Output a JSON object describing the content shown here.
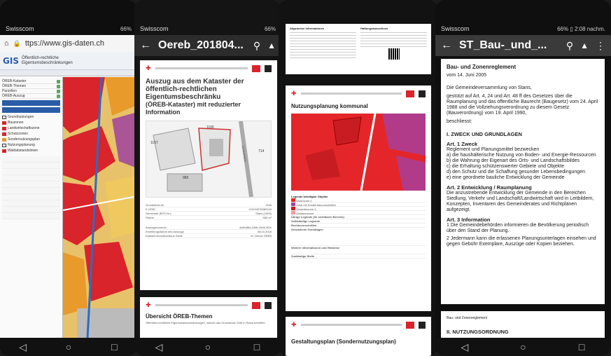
{
  "phone1": {
    "carrier": "Swisscom",
    "status_right": "66%",
    "url": "ttps://www.gis-daten.ch",
    "gis_logo": "GIS",
    "gis_title": [
      "Öffentlich-rechtliche",
      "Eigentumsbeschränkungen"
    ],
    "panel_rows": [
      "ÖREB-Kataster",
      "ÖREB-Themen",
      "Parzellen",
      "ÖREB-Auszug"
    ],
    "legend_labels": [
      "Grundnutzungen",
      "Bauzonen",
      "Landwirtschaftszone",
      "Schutzzonen",
      "Sondernutzungsplan",
      "Nutzungsplanung",
      "Waldabstandslinien"
    ],
    "nav": [
      "◁",
      "○",
      "□"
    ],
    "colors": {
      "accent": "#2a5da8",
      "zone_red": "#d8242a",
      "zone_orange": "#e89a2a",
      "zone_yellow": "#f0c860",
      "zone_purple": "#9a3aa0"
    }
  },
  "phone2": {
    "carrier": "Swisscom",
    "status_right": "66%",
    "title": "Oereb_201804...",
    "doc_heading": [
      "Auszug aus dem Kataster der",
      "öffentlich-rechtlichen Eigentumsbeschränku",
      "(ÖREB-Kataster) mit reduzierter Information"
    ],
    "parcels": [
      "1167",
      "1166",
      "983",
      "714"
    ],
    "street": "Ayriaustrasse",
    "fields": [
      [
        "Grundstück-Nr.",
        "1166"
      ],
      [
        "E-GRID",
        "CH234976589194"
      ],
      [
        "Gemeinde (BFS-Nr.)",
        "Stans (1509)"
      ],
      [
        "Fläche",
        "583 m²"
      ]
    ],
    "fields2": [
      [
        "Auszugsnummer",
        "4c66df8d-346b-43d6-9f2e"
      ],
      [
        "Erstellungsdatum des Auszugs",
        "08.04.2018"
      ],
      [
        "Katasterverantwortliche Stelle",
        "Kt. Dienst ÖREB"
      ]
    ],
    "page2_title": "Übersicht ÖREB-Themen",
    "page2_sub": "Öffentlich-rechtliche Eigentumsbeschränkungen, welche das Grundstück 1166 in Stans betreffen",
    "nav": [
      "◁",
      "○",
      "□"
    ]
  },
  "phone3": {
    "top_heading": "Allgemeine Informationen",
    "top_heading2": "Haftungsausschluss",
    "section_title": "Nutzungsplanung kommunal",
    "legend_header": "Legende beteiligter Objekte",
    "legend_rows": [
      "Wohnzone 2",
      "Zone mit Sonderbauvorschriften",
      "Gewerbezone 3",
      "Gefahrenzone"
    ],
    "other_rows": [
      "Übrige Legende (im sichtbaren Bereich)",
      "Vollständige Legende",
      "Rechtsvorschriften",
      "Gesetzliche Grundlagen",
      "Weitere Informationen und Hinweise",
      "Zuständige Stelle"
    ],
    "bottom_title": "Gestaltungsplan (Sondernutzungsplan)"
  },
  "phone4": {
    "carrier": "Swisscom",
    "status_right": "66% ▯ 2:08 nachm.",
    "title": "ST_Bau-_und_...",
    "heading": "Bau- und Zonenreglement",
    "date": "vom 14. Juni 2005",
    "intro": "Die Gemeindeversammlung von Stans,",
    "basis": "gestützt auf Art. 4, 24 und Art. 48 ff des Gesetzes über die Raumplanung und das öffentliche Baurecht (Baugesetz) vom 24. April 1988 und die Vollziehungsverordnung zu diesem Gesetz (Bauverordnung) vom 19. April 1990,",
    "beschliesst": "beschliesst:",
    "chapter1": "I.    ZWECK UND GRUNDLAGEN",
    "art1_title": "Art. 1      Zweck",
    "art1_text": [
      "Reglement und Planungsmittel bezwecken",
      "a)  die haushälterische Nutzung von Boden- und Energie-Ressourcen",
      "b)  die Wahrung der Eigenart des Orts- und Landschaftsbildes",
      "c)  die Erhaltung schützenswerter Gebiete und Objekte",
      "d)  den Schutz und die Schaffung gesunder Lebensbedingungen",
      "e)  eine geordnete bauliche Entwicklung der Gemeinde"
    ],
    "art2_title": "Art. 2      Entwicklung / Raumplanung",
    "art2_text": "Die anzustrebende Entwicklung der Gemeinde in den Bereichen Siedlung, Verkehr und Landschaft/Landwirtschaft wird in Leitbildern, Konzepten, Inventaren des Gemeinderates und Richtplänen aufgezeigt.",
    "art3_title": "Art. 3      Information",
    "art3_text1": "1 Die Gemeindebehörden informieren die Bevölkerung periodisch über den Stand der Planung.",
    "art3_text2": "2 Jedermann kann die erlassenen Planungsunterlagen einsehen und gegen Gebühr Exemplare, Auszüge oder Kopien beziehen.",
    "footer": "Bau- und Zonenreglement",
    "chapter2": "II.    NUTZUNGSORDNUNG",
    "nav": [
      "◁",
      "○",
      "□"
    ]
  }
}
